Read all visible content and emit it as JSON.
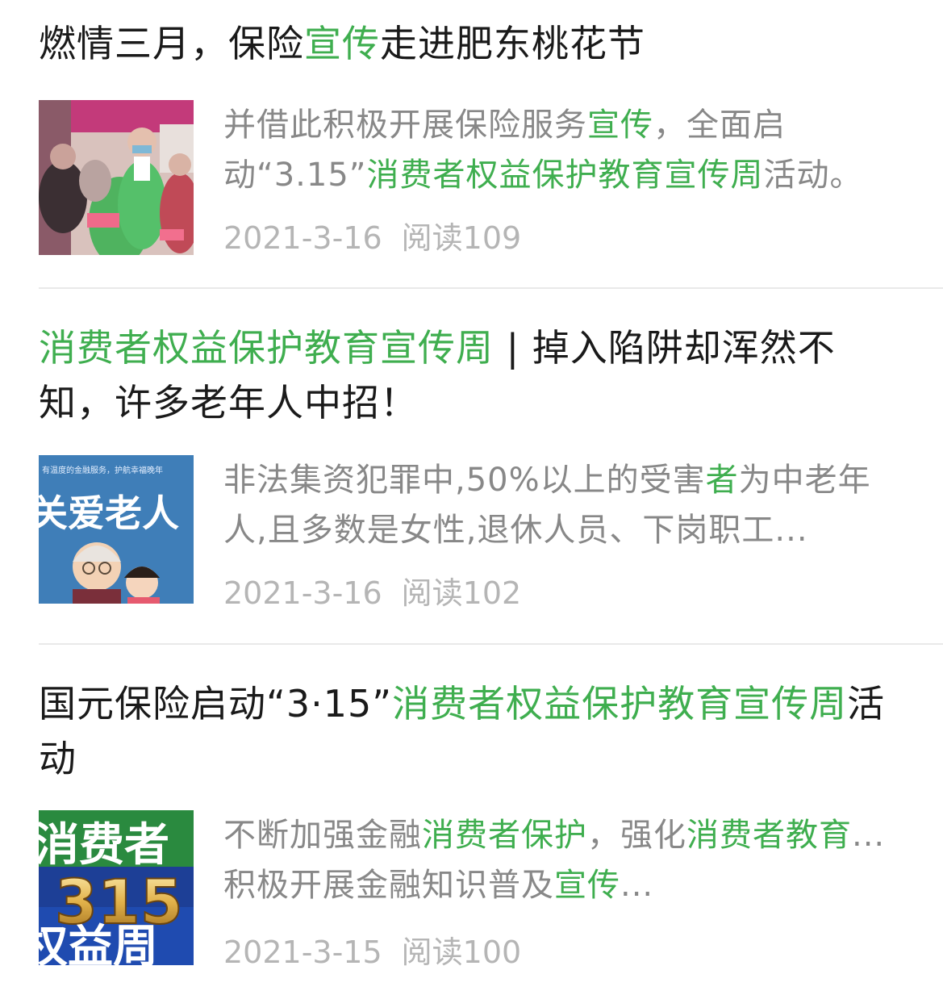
{
  "articles": [
    {
      "title_parts": [
        {
          "text": "燃情三月，保险",
          "highlight": false
        },
        {
          "text": "宣传",
          "highlight": true
        },
        {
          "text": "走进肥东桃花节",
          "highlight": false
        }
      ],
      "summary_parts": [
        {
          "text": "并借此积极开展保险服务",
          "highlight": false
        },
        {
          "text": "宣传",
          "highlight": true
        },
        {
          "text": "，全面启动“3.15”",
          "highlight": false
        },
        {
          "text": "消费者权益保护教育宣传周",
          "highlight": true
        },
        {
          "text": "活动。",
          "highlight": false
        }
      ],
      "date": "2021-3-16",
      "reads": "阅读109",
      "thumbnail": "photo-volunteer-elderly-crowd"
    },
    {
      "title_parts": [
        {
          "text": "消费者权益保护教育宣传周",
          "highlight": true
        },
        {
          "text": " | 掉入陷阱却浑然不知，许多老年人中招！",
          "highlight": false
        }
      ],
      "summary_parts": [
        {
          "text": "非法集资犯罪中,50%以上的受害",
          "highlight": false
        },
        {
          "text": "者",
          "highlight": true
        },
        {
          "text": "为中老年人,且多数是女性,退休人员、下岗职工...",
          "highlight": false
        }
      ],
      "date": "2021-3-16",
      "reads": "阅读102",
      "thumbnail": "cartoon-care-for-elderly",
      "thumbnail_text": "关爱老人",
      "thumbnail_small_text": "有温度的金融服务，护航幸福晚年"
    },
    {
      "title_parts": [
        {
          "text": "国元保险启动“3·15”",
          "highlight": false
        },
        {
          "text": "消费者权益保护教育宣传周",
          "highlight": true
        },
        {
          "text": "活动",
          "highlight": false
        }
      ],
      "summary_parts": [
        {
          "text": "不断加强金融",
          "highlight": false
        },
        {
          "text": "消费者保护",
          "highlight": true
        },
        {
          "text": "，强化",
          "highlight": false
        },
        {
          "text": "消费者教育",
          "highlight": true
        },
        {
          "text": "...积极开展金融知识普及",
          "highlight": false
        },
        {
          "text": "宣传",
          "highlight": true
        },
        {
          "text": "...",
          "highlight": false
        }
      ],
      "date": "2021-3-15",
      "reads": "阅读100",
      "thumbnail": "poster-315-consumer-rights",
      "thumbnail_text": "315"
    }
  ],
  "colors": {
    "highlight": "#3fae4f",
    "title": "#1a1a1a",
    "summary": "#888888",
    "meta": "#b5b5b5",
    "divider": "#e9e9e9"
  }
}
